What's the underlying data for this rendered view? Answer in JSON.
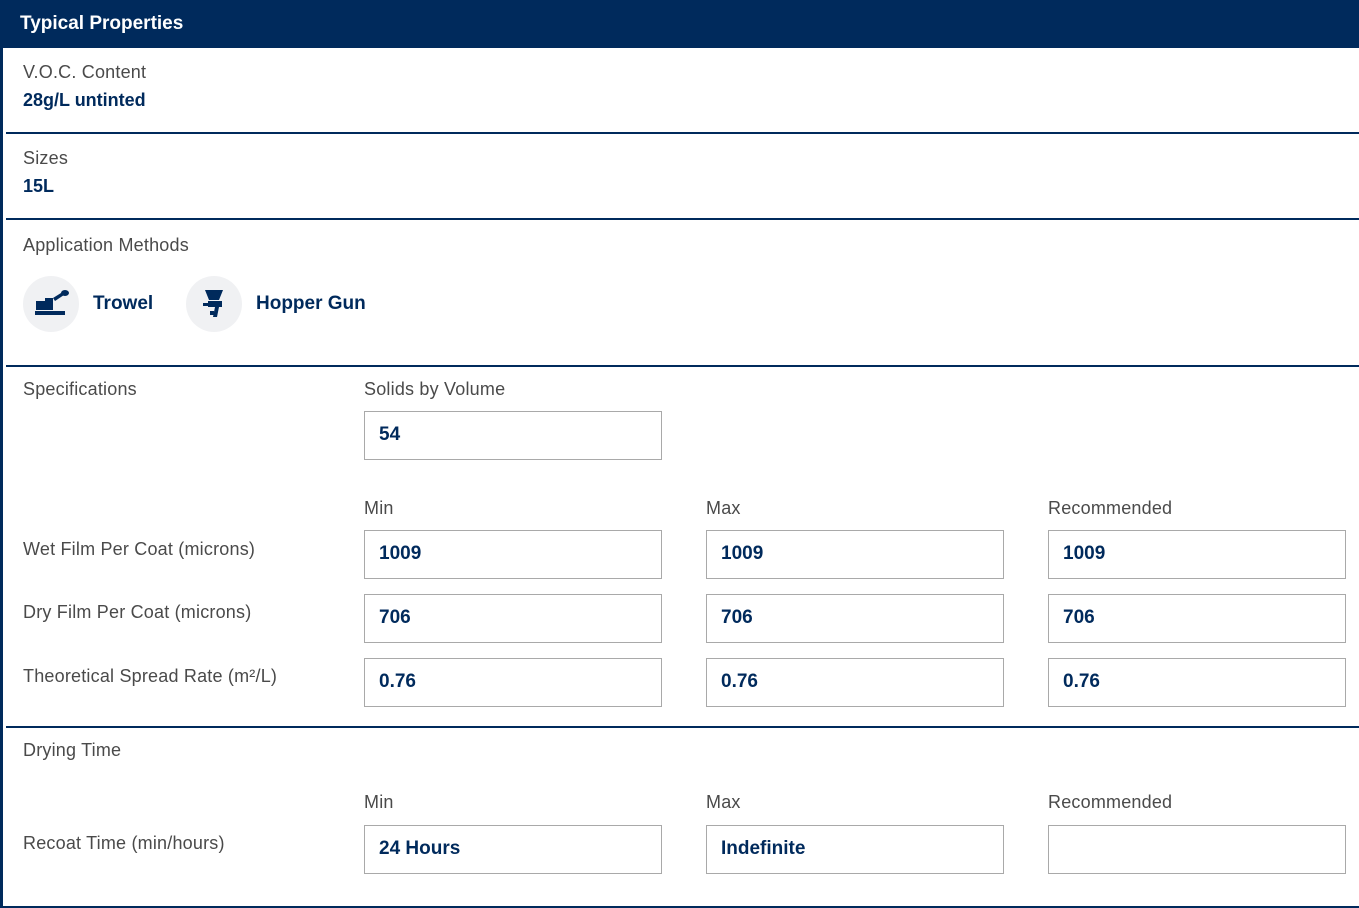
{
  "header": {
    "title": "Typical Properties"
  },
  "voc": {
    "label": "V.O.C. Content",
    "value": "28g/L untinted"
  },
  "sizes": {
    "label": "Sizes",
    "value": "15L"
  },
  "application": {
    "label": "Application Methods",
    "methods": [
      {
        "label": "Trowel",
        "icon": "trowel-icon"
      },
      {
        "label": "Hopper Gun",
        "icon": "hopper-gun-icon"
      }
    ]
  },
  "specifications": {
    "label": "Specifications",
    "solids_label": "Solids by Volume",
    "solids_value": "54",
    "columns": [
      "Min",
      "Max",
      "Recommended"
    ],
    "rows": [
      {
        "label": "Wet Film Per Coat (microns)",
        "min": "1009",
        "max": "1009",
        "recommended": "1009"
      },
      {
        "label": "Dry Film Per Coat (microns)",
        "min": "706",
        "max": "706",
        "recommended": "706"
      },
      {
        "label": "Theoretical Spread Rate (m²/L)",
        "min": "0.76",
        "max": "0.76",
        "recommended": "0.76"
      }
    ]
  },
  "drying": {
    "label": "Drying Time",
    "columns": [
      "Min",
      "Max",
      "Recommended"
    ],
    "rows": [
      {
        "label": "Recoat Time (min/hours)",
        "min": "24 Hours",
        "max": "Indefinite",
        "recommended": ""
      }
    ]
  },
  "colors": {
    "brand": "#002a5c",
    "icon_bg": "#f0f1f3",
    "field_border": "#a9a9a9"
  }
}
